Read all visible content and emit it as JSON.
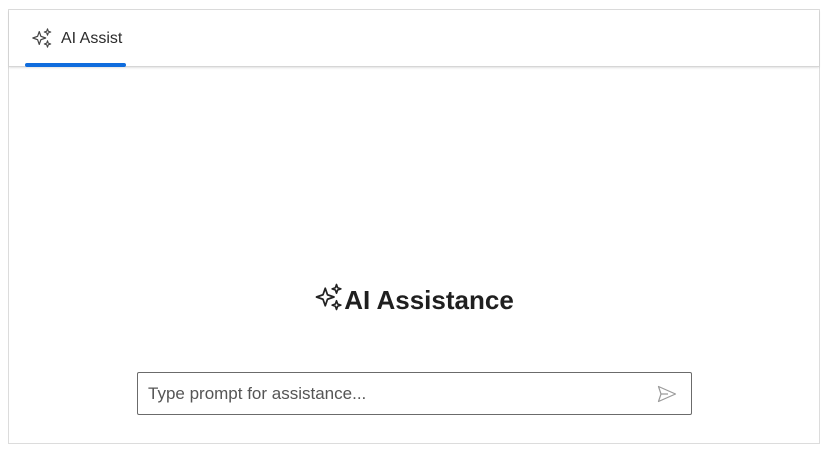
{
  "tabs": [
    {
      "label": "AI Assist",
      "icon": "sparkle-icon",
      "active": true
    }
  ],
  "main": {
    "heading": "AI Assistance",
    "heading_icon": "sparkle-icon"
  },
  "prompt": {
    "placeholder": "Type prompt for assistance...",
    "value": "",
    "send_icon": "send-icon"
  },
  "colors": {
    "accent": "#0f6cdd",
    "border": "#dcdcdc",
    "text": "#1f1f1f"
  }
}
